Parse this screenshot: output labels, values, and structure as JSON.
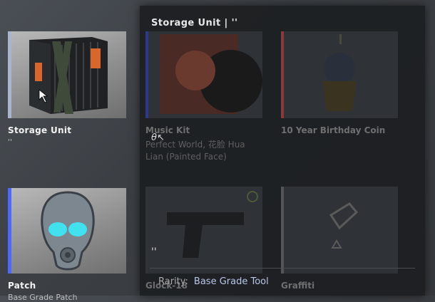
{
  "left_items": [
    {
      "title": "Storage Unit",
      "subtitle": "''",
      "rarity_color": "#aab4cc"
    },
    {
      "title": "Patch",
      "subtitle": "Base Grade Patch",
      "rarity_color": "#4b69ff"
    }
  ],
  "tooltip": {
    "title": "Storage Unit | ''",
    "name_value": "''",
    "rarity_label": "Rarity:",
    "rarity_value": "Base Grade Tool",
    "glyph": "θ↖"
  },
  "background_grid": [
    {
      "label": "Music Kit",
      "sub": "Perfect World, 花脸 Hua Lian (Painted Face)"
    },
    {
      "label": "10 Year Birthday Coin",
      "sub": ""
    },
    {
      "label": "Glock-18",
      "sub": ""
    },
    {
      "label": "Graffiti",
      "sub": ""
    }
  ],
  "colors": {
    "accent": "#4b69ff",
    "music_bar": "#2b3a8a",
    "coin_bar": "#8a3a3a"
  }
}
